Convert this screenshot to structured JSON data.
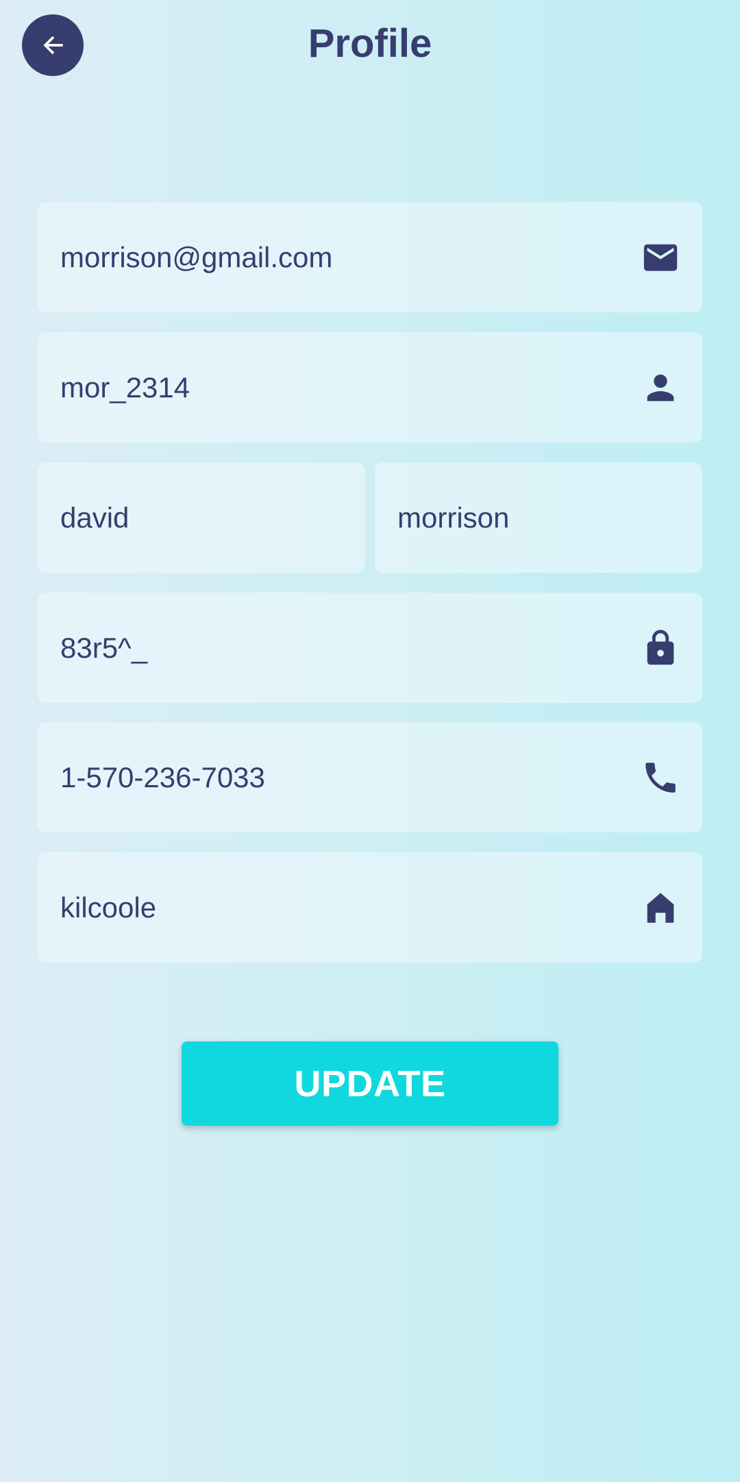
{
  "header": {
    "title": "Profile",
    "back_icon": "arrow-left-icon"
  },
  "form": {
    "email": {
      "value": "morrison@gmail.com",
      "icon": "email-icon"
    },
    "username": {
      "value": "mor_2314",
      "icon": "person-icon"
    },
    "first_name": {
      "value": "david"
    },
    "last_name": {
      "value": "morrison"
    },
    "password": {
      "value": "83r5^_",
      "icon": "lock-icon"
    },
    "phone": {
      "value": "1-570-236-7033",
      "icon": "phone-icon"
    },
    "city": {
      "value": "kilcoole",
      "icon": "home-icon"
    }
  },
  "actions": {
    "update_label": "UPDATE"
  },
  "colors": {
    "primary": "#373d6e",
    "accent": "#0fd9df",
    "background_start": "#dcedf7",
    "background_end": "#bdeef3"
  }
}
